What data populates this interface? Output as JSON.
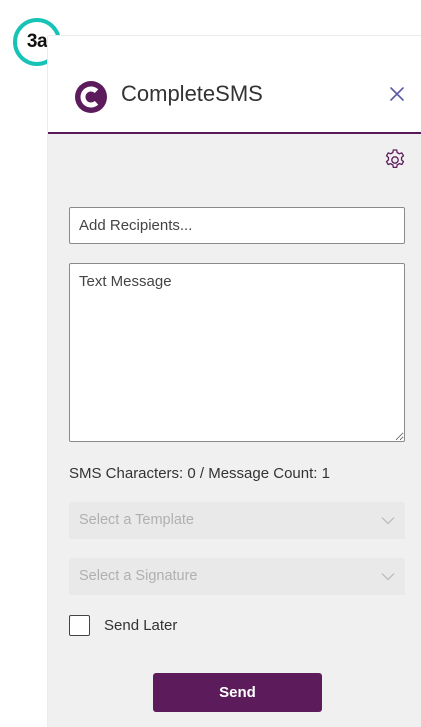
{
  "step_badge": "3a",
  "header": {
    "title": "CompleteSMS",
    "logo_icon": "completesms-logo-icon",
    "close_icon": "close-icon"
  },
  "toolbar": {
    "settings_icon": "gear-icon"
  },
  "form": {
    "recipients_placeholder": "Add Recipients...",
    "message_placeholder": "Text Message",
    "char_count": "SMS Characters: 0 / Message Count: 1",
    "template_placeholder": "Select a Template",
    "signature_placeholder": "Select a Signature",
    "send_later_label": "Send Later",
    "send_later_checked": false,
    "send_label": "Send"
  },
  "colors": {
    "brand": "#5c1c5c",
    "badge_ring": "#17c3b6",
    "panel_bg": "#f0f0f0"
  }
}
